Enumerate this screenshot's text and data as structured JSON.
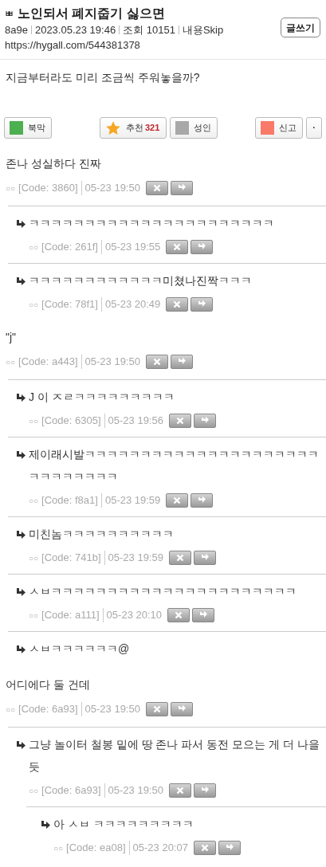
{
  "post": {
    "board_mark": "ㅃ",
    "title": "노인되서 폐지줍기 싫으면",
    "author": "8a9e",
    "date": "2023.05.23 19:46",
    "views": "조회 10151",
    "skip": "내용Skip",
    "url": "https://hygall.com/544381378",
    "write_button": "글쓰기",
    "body": "지금부터라도 미리 조금씩 주워놓을까?"
  },
  "actions": [
    {
      "kind": "bookmark",
      "label": "북막",
      "color": "#4caf50"
    },
    {
      "kind": "recommend",
      "label": "추천",
      "count": "321"
    },
    {
      "kind": "adult",
      "label": "성인",
      "color": "#a8a8a8"
    },
    {
      "kind": "report",
      "label": "신고",
      "color": "#fa7a6a"
    },
    {
      "kind": "more",
      "label": "·"
    }
  ],
  "comments": [
    {
      "nick": "○○",
      "text": "존나 성실하다 진짜",
      "code": "[Code: 3860]",
      "time": "05-23 19:50",
      "children": [
        {
          "nick": "○○",
          "text": "ㅋㅋㅋㅋㅋㅋㅋㅋㅋㅋㅋㅋㅋㅋㅋㅋㅋㅋㅋㅋㅋㅋ",
          "code": "[Code: 261f]",
          "time": "05-23 19:55"
        },
        {
          "nick": "○○",
          "text": "ㅋㅋㅋㅋㅋㅋㅋㅋㅋㅋㅋㅋ미쳤나진짝ㅋㅋㅋ",
          "code": "[Code: 78f1]",
          "time": "05-23 20:49"
        }
      ]
    },
    {
      "nick": "○○",
      "text": "\"j\"",
      "code": "[Code: a443]",
      "time": "05-23 19:50",
      "children": [
        {
          "nick": "○○",
          "text": "J 이 ㅈㄹㅋㅋㅋㅋㅋㅋㅋㅋㅋ",
          "code": "[Code: 6305]",
          "time": "05-23 19:56"
        },
        {
          "nick": "○○",
          "text": "제이래시발ㅋㅋㅋㅋㅋㅋㅋㅋㅋㅋㅋㅋㅋㅋㅋㅋㅋㅋㅋㅋㅋㅋㅋㅋㅋㅋㅋㅋㅋ",
          "code": "[Code: f8a1]",
          "time": "05-23 19:59"
        },
        {
          "nick": "○○",
          "text": "미친놈ㅋㅋㅋㅋㅋㅋㅋㅋㅋㅋ",
          "code": "[Code: 741b]",
          "time": "05-23 19:59"
        },
        {
          "nick": "○○",
          "text": "ㅅㅂㅋㅋㅋㅋㅋㅋㅋㅋㅋㅋㅋㅋㅋㅋㅋㅋㅋㅋㅋㅋㅋㅋ",
          "code": "[Code: a111]",
          "time": "05-23 20:10"
        },
        {
          "text": "ㅅㅂㅋㅋㅋㅋㅋㅋ@"
        }
      ]
    },
    {
      "nick": "○○",
      "text": "어디에다 둘 건데",
      "code": "[Code: 6a93]",
      "time": "05-23 19:50",
      "children": [
        {
          "nick": "○○",
          "text": "그냥 놀이터 철봉 밑에 땅 존나 파서 동전 모으는 게 더 나을 듯",
          "code": "[Code: 6a93]",
          "time": "05-23 19:50",
          "children": [
            {
              "nick": "○○",
              "text": "아 ㅅㅂ ㅋㅋㅋㅋㅋㅋㅋㅋㅋ",
              "code": "[Code: ea08]",
              "time": "05-23 20:07"
            }
          ]
        }
      ]
    }
  ]
}
